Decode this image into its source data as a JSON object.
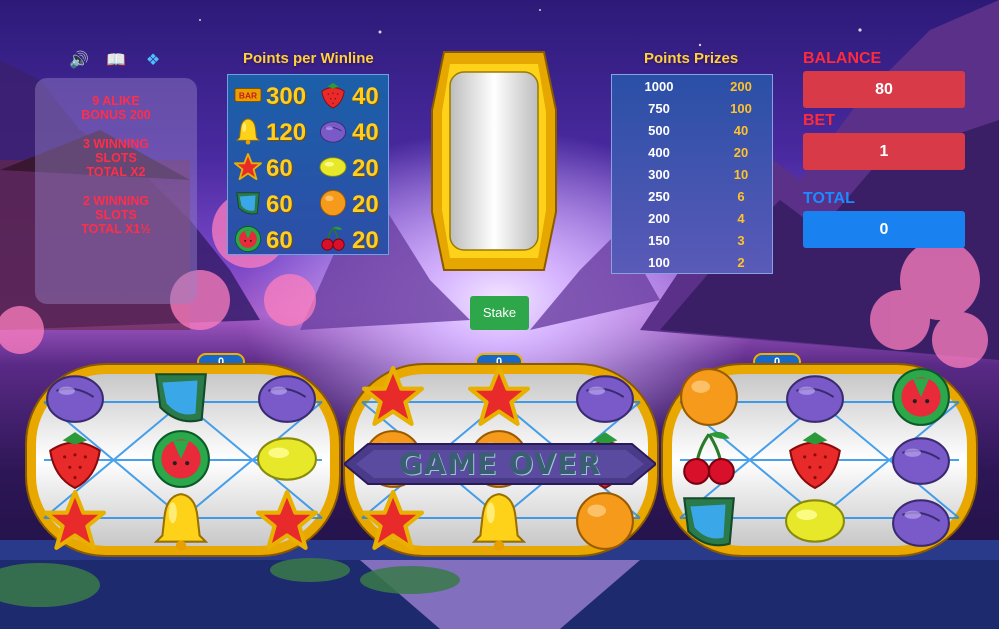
{
  "top_icons": [
    {
      "name": "sound-icon",
      "glyph": "🔊"
    },
    {
      "name": "book-icon",
      "glyph": "📖"
    },
    {
      "name": "fullscreen-icon",
      "glyph": "❖"
    }
  ],
  "bonus_panel": {
    "line1": "9 ALIKE BONUS 200",
    "line2": "3 WINNING SLOTS TOTAL X2",
    "line3": "2 WINNING SLOTS TOTAL X1½"
  },
  "winline": {
    "title": "Points per Winline",
    "rows": [
      {
        "left_symbol": "bar",
        "left_value": "300",
        "right_symbol": "strawberry",
        "right_value": "40"
      },
      {
        "left_symbol": "bell",
        "left_value": "120",
        "right_symbol": "plum",
        "right_value": "40"
      },
      {
        "left_symbol": "star",
        "left_value": "60",
        "right_symbol": "lemon",
        "right_value": "20"
      },
      {
        "left_symbol": "leaf",
        "left_value": "60",
        "right_symbol": "orange",
        "right_value": "20"
      },
      {
        "left_symbol": "watermelon",
        "left_value": "60",
        "right_symbol": "cherry",
        "right_value": "20"
      }
    ],
    "bar_label": "BAR"
  },
  "prizes": {
    "title": "Points Prizes",
    "rows": [
      {
        "a": "1000",
        "b": "200"
      },
      {
        "a": "750",
        "b": "100"
      },
      {
        "a": "500",
        "b": "40"
      },
      {
        "a": "400",
        "b": "20"
      },
      {
        "a": "300",
        "b": "10"
      },
      {
        "a": "250",
        "b": "6"
      },
      {
        "a": "200",
        "b": "4"
      },
      {
        "a": "150",
        "b": "3"
      },
      {
        "a": "100",
        "b": "2"
      }
    ]
  },
  "balance": {
    "label": "BALANCE",
    "value": "80",
    "color": "#d93a48"
  },
  "bet": {
    "label": "BET",
    "value": "1",
    "color": "#d93a48"
  },
  "total": {
    "label": "TOTAL",
    "value": "0",
    "color": "#1a82f0"
  },
  "stake_label": "Stake",
  "reel_counters": [
    "0",
    "0",
    "0"
  ],
  "game_over": "GAME OVER",
  "reels": [
    [
      "plum",
      "leaf",
      "plum",
      "strawberry",
      "watermelon",
      "lemon",
      "star",
      "bell",
      "star"
    ],
    [
      "star",
      "star",
      "plum",
      "orange",
      "orange",
      "strawberry",
      "star",
      "bell",
      "orange"
    ],
    [
      "orange",
      "plum",
      "watermelon",
      "cherry",
      "strawberry",
      "plum",
      "leaf",
      "lemon",
      "plum"
    ]
  ]
}
